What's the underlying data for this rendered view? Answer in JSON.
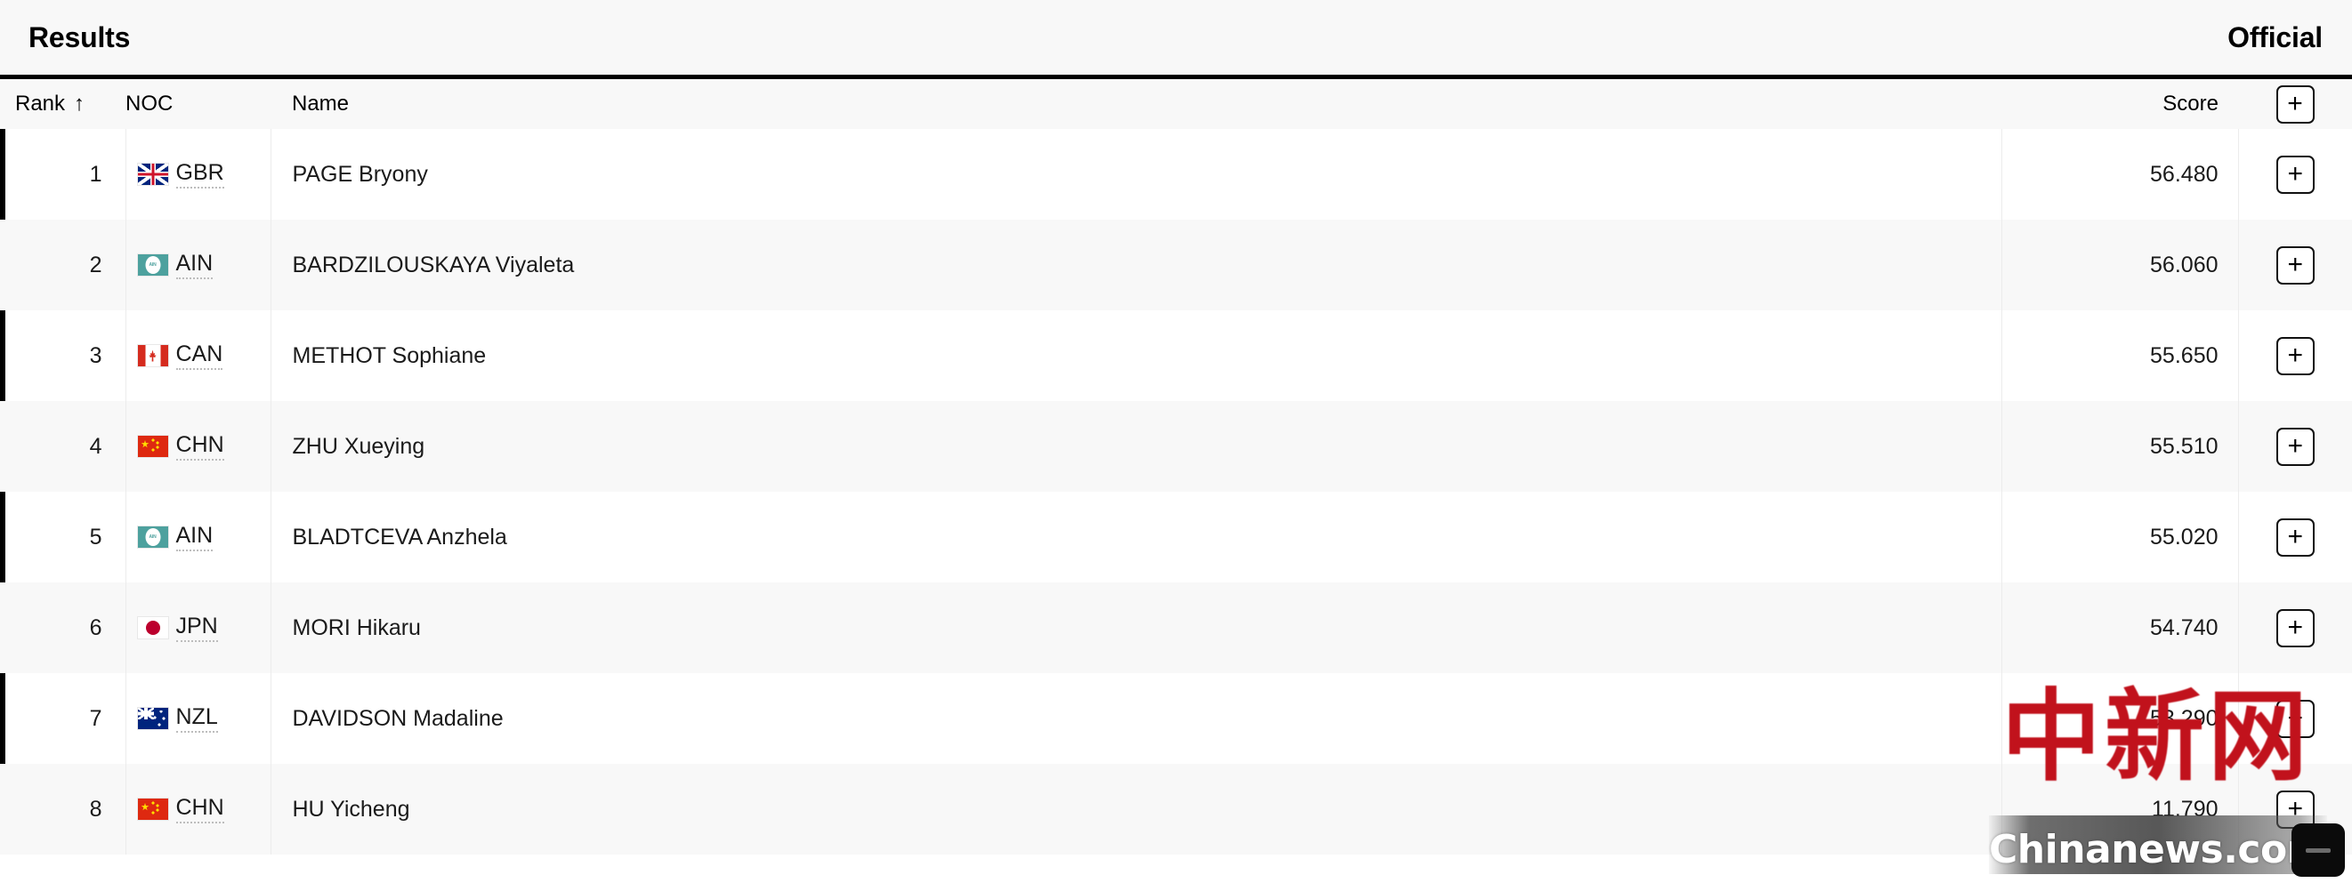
{
  "header": {
    "title": "Results",
    "status": "Official"
  },
  "table": {
    "columns": {
      "rank": "Rank",
      "sort_icon": "↑",
      "noc": "NOC",
      "name": "Name",
      "score": "Score",
      "add": "+"
    },
    "rows": [
      {
        "rank": "1",
        "noc": "GBR",
        "flag": "flag-gbr",
        "name": "PAGE Bryony",
        "score": "56.480",
        "add": "+"
      },
      {
        "rank": "2",
        "noc": "AIN",
        "flag": "flag-ain",
        "name": "BARDZILOUSKAYA Viyaleta",
        "score": "56.060",
        "add": "+"
      },
      {
        "rank": "3",
        "noc": "CAN",
        "flag": "flag-can",
        "name": "METHOT Sophiane",
        "score": "55.650",
        "add": "+"
      },
      {
        "rank": "4",
        "noc": "CHN",
        "flag": "flag-chn",
        "name": "ZHU Xueying",
        "score": "55.510",
        "add": "+"
      },
      {
        "rank": "5",
        "noc": "AIN",
        "flag": "flag-ain",
        "name": "BLADTCEVA Anzhela",
        "score": "55.020",
        "add": "+"
      },
      {
        "rank": "6",
        "noc": "JPN",
        "flag": "flag-jpn",
        "name": "MORI Hikaru",
        "score": "54.740",
        "add": "+"
      },
      {
        "rank": "7",
        "noc": "NZL",
        "flag": "flag-nzl",
        "name": "DAVIDSON Madaline",
        "score": "53.290",
        "add": "+"
      },
      {
        "rank": "8",
        "noc": "CHN",
        "flag": "flag-chn",
        "name": "HU Yicheng",
        "score": "11.790",
        "add": "+"
      }
    ]
  },
  "watermark": {
    "characters": "中新网",
    "domain": "Chinanews.com"
  },
  "floating_button": {
    "icon": "minimize-icon"
  },
  "colors": {
    "accent_rule": "#000000",
    "header_background": "#f8f8f8",
    "row_alt_background": "#f8f8f8",
    "watermark_red": "#c1121c"
  }
}
